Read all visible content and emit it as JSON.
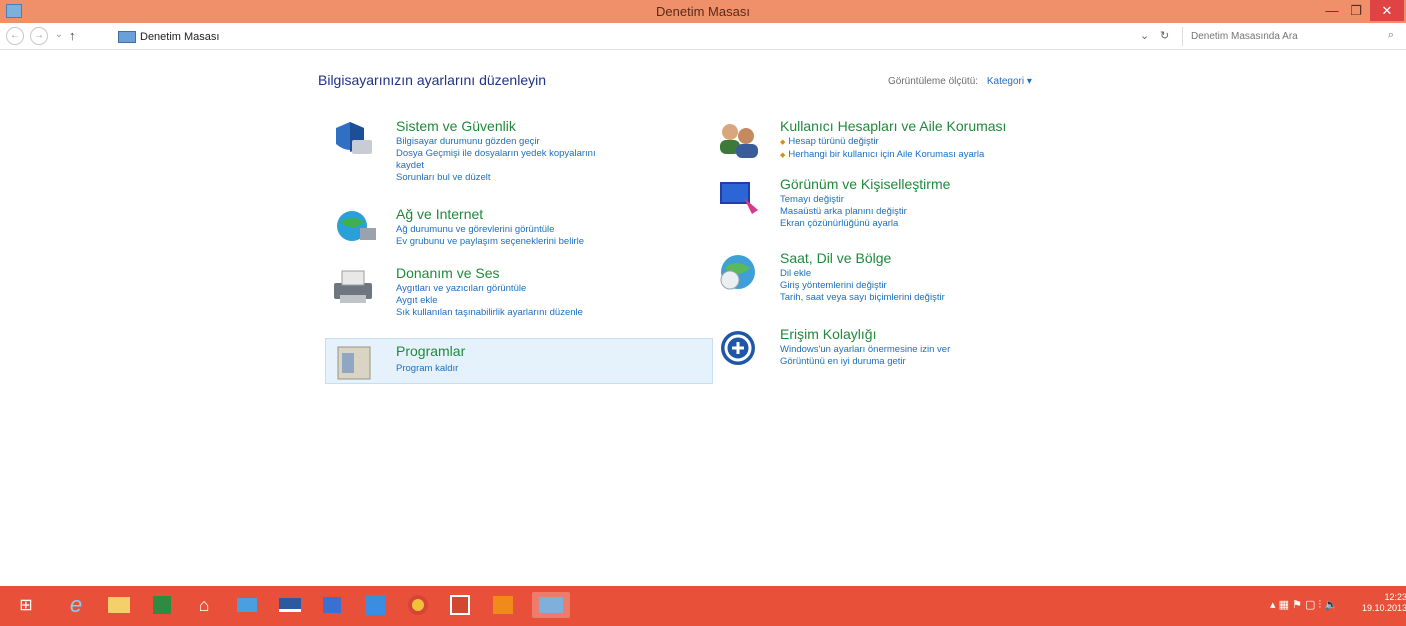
{
  "window": {
    "title": "Denetim Masası",
    "minimize_glyph": "—",
    "maximize_glyph": "❐",
    "close_glyph": "✕"
  },
  "address": {
    "back_glyph": "←",
    "forward_glyph": "→",
    "dropdown_glyph": "⌄",
    "up_glyph": "↑",
    "path": "Denetim Masası",
    "dropdown_arrow": "⌄",
    "refresh_glyph": "↻",
    "search_placeholder": "Denetim Masasında Ara",
    "search_glyph": "⌕"
  },
  "main": {
    "heading": "Bilgisayarınızın ayarlarını düzenleyin",
    "view_by_label": "Görüntüleme ölçütü:",
    "view_by_value": "Kategori ▾"
  },
  "categories": [
    {
      "title": "Sistem ve Güvenlik",
      "icon": "shield-computer-icon",
      "links": [
        "Bilgisayar durumunu gözden geçir",
        "Dosya Geçmişi ile dosyaların yedek kopyalarını",
        "kaydet",
        "Sorunları bul ve düzelt"
      ]
    },
    {
      "title": "Ağ ve Internet",
      "icon": "network-globe-icon",
      "links": [
        "Ağ durumunu ve görevlerini görüntüle",
        "Ev grubunu ve paylaşım seçeneklerini belirle"
      ]
    },
    {
      "title": "Donanım ve Ses",
      "icon": "printer-hardware-icon",
      "links": [
        "Aygıtları ve yazıcıları görüntüle",
        "Aygıt ekle",
        "Sık kullanılan taşınabilirlik ayarlarını düzenle"
      ]
    },
    {
      "title": "Programlar",
      "icon": "programs-icon",
      "links": [
        "Program kaldır"
      ]
    },
    {
      "title": "Kullanıcı Hesapları ve Aile Koruması",
      "icon": "users-icon",
      "links": [
        "Hesap türünü değiştir",
        "Herhangi bir kullanıcı için Aile Koruması ayarla"
      ]
    },
    {
      "title": "Görünüm ve Kişiselleştirme",
      "icon": "appearance-icon",
      "links": [
        "Temayı değiştir",
        "Masaüstü arka planını değiştir",
        "Ekran çözünürlüğünü ayarla"
      ]
    },
    {
      "title": "Saat, Dil ve Bölge",
      "icon": "clock-globe-icon",
      "links": [
        "Dil ekle",
        "Giriş yöntemlerini değiştir",
        "Tarih, saat veya sayı biçimlerini değiştir"
      ]
    },
    {
      "title": "Erişim Kolaylığı",
      "icon": "accessibility-icon",
      "links": [
        "Windows'un ayarları önermesine izin ver",
        "Görüntünü en iyi duruma getir"
      ]
    }
  ],
  "taskbar": {
    "start_glyph": "⊞",
    "ie_glyph": "e",
    "items": [
      "folder",
      "store",
      "home",
      "mail",
      "desktop",
      "media",
      "skype",
      "chrome",
      "powerpoint",
      "player",
      "control-panel"
    ],
    "tray_text": "▴ ▦ ⚑ ▢ ⫶ 🔈",
    "clock_time": "12:23",
    "clock_date": "19.10.2013"
  }
}
